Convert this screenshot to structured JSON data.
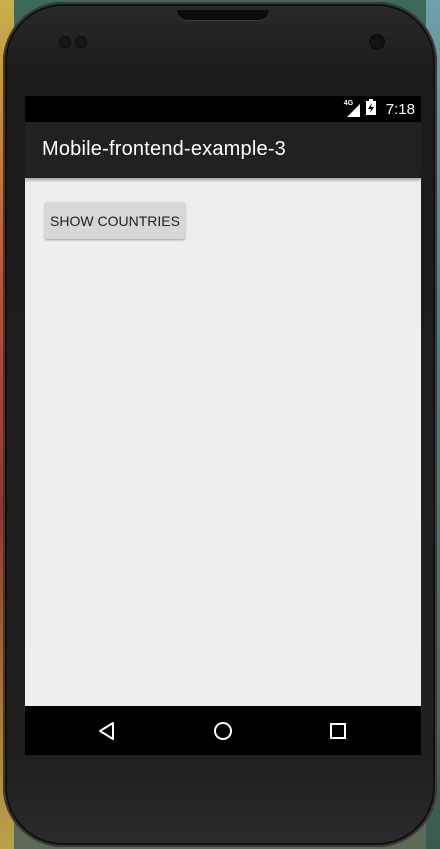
{
  "status_bar": {
    "network_label": "4G",
    "time": "7:18"
  },
  "action_bar": {
    "title": "Mobile-frontend-example-3"
  },
  "main": {
    "show_countries_label": "SHOW COUNTRIES"
  },
  "nav_bar": {
    "back_icon": "back-triangle-icon",
    "home_icon": "home-circle-icon",
    "recents_icon": "recents-square-icon"
  },
  "colors": {
    "status_bar": "#000000",
    "action_bar": "#212121",
    "content_background": "#eeeeee",
    "button_background": "#d6d7d7",
    "nav_bar": "#000000"
  }
}
